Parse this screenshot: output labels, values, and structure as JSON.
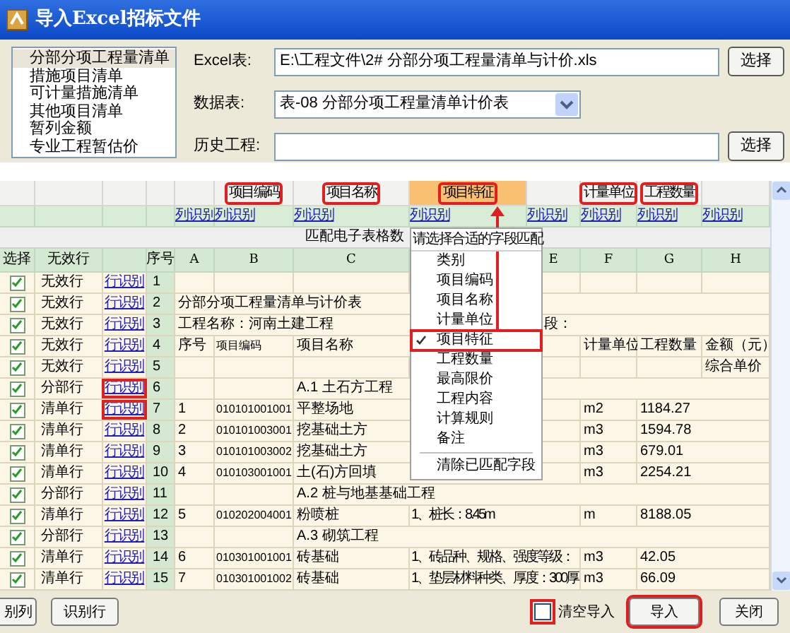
{
  "window": {
    "title": "导入Excel招标文件"
  },
  "sheet_list": {
    "items": [
      {
        "label": "分部分项工程量清单",
        "selected": true
      },
      {
        "label": "措施项目清单",
        "selected": false
      },
      {
        "label": "可计量措施清单",
        "selected": false
      },
      {
        "label": "其他项目清单",
        "selected": false
      },
      {
        "label": "暂列金额",
        "selected": false
      },
      {
        "label": "专业工程暂估价",
        "selected": false
      }
    ]
  },
  "form": {
    "excel_file": {
      "label": "Excel表:",
      "value": "E:\\工程文件\\2# 分部分项工程量清单与计价.xls",
      "button": "选择"
    },
    "data_sheet": {
      "label": "数据表:",
      "value": "表-08 分部分项工程量清单计价表"
    },
    "history_project": {
      "label": "历史工程:",
      "button": "选择"
    }
  },
  "grid": {
    "fixed_headers": {
      "select": "选择",
      "row_type": "无效行",
      "seq": "序号"
    },
    "banner": "匹配电子表格数",
    "columns": [
      {
        "header": "A",
        "link": "列识别",
        "active": false
      },
      {
        "header": "B",
        "link": "列识别",
        "field": "项目编码",
        "active": false,
        "highlighted": true
      },
      {
        "header": "C",
        "link": "列识别",
        "field": "项目名称",
        "active": false,
        "highlighted": true
      },
      {
        "link": "列识别",
        "field": "项目特征",
        "active": true,
        "highlighted": true
      },
      {
        "header": "E",
        "link": "列识别",
        "active": false
      },
      {
        "header": "F",
        "link": "列识别",
        "field": "计量单位",
        "active": false,
        "highlighted": true
      },
      {
        "header": "G",
        "link": "列识别",
        "field": "工程数量",
        "active": false,
        "highlighted": true
      },
      {
        "header": "H",
        "link": "列识别",
        "active": false
      }
    ],
    "rows": [
      {
        "checked": true,
        "type": "无效行",
        "link": "行识别",
        "highlighted": false,
        "seq": "1",
        "cells": {}
      },
      {
        "checked": true,
        "type": "无效行",
        "link": "行识别",
        "highlighted": false,
        "seq": "2",
        "cells": {
          "A": "分部分项工程量清单与计价表"
        }
      },
      {
        "checked": true,
        "type": "无效行",
        "link": "行识别",
        "highlighted": false,
        "seq": "3",
        "cells": {
          "A": "工程名称：河南土建工程",
          "E": "段："
        }
      },
      {
        "checked": true,
        "type": "无效行",
        "link": "行识别",
        "highlighted": false,
        "seq": "4",
        "cells": {
          "A": "序号",
          "B": "项目编码",
          "C": "项目名称",
          "F": "计量单位",
          "G": "工程数量",
          "H": "金额（元）"
        }
      },
      {
        "checked": true,
        "type": "无效行",
        "link": "行识别",
        "highlighted": false,
        "seq": "5",
        "cells": {
          "H": "综合单价"
        }
      },
      {
        "checked": true,
        "type": "分部行",
        "link": "行识别",
        "highlighted": true,
        "seq": "6",
        "cells": {
          "C": "A.1 土石方工程"
        }
      },
      {
        "checked": true,
        "type": "清单行",
        "link": "行识别",
        "highlighted": true,
        "seq": "7",
        "cells": {
          "A": "1",
          "B": "010101001001",
          "C": "平整场地",
          "F": "m2",
          "G": "1184.27"
        }
      },
      {
        "checked": true,
        "type": "清单行",
        "link": "行识别",
        "highlighted": false,
        "seq": "8",
        "cells": {
          "A": "2",
          "B": "010101003001",
          "C": "挖基础土方",
          "F": "m3",
          "G": "1594.78"
        }
      },
      {
        "checked": true,
        "type": "清单行",
        "link": "行识别",
        "highlighted": false,
        "seq": "9",
        "cells": {
          "A": "3",
          "B": "010101003002",
          "C": "挖基础土方",
          "F": "m3",
          "G": "679.01"
        }
      },
      {
        "checked": true,
        "type": "清单行",
        "link": "行识别",
        "highlighted": false,
        "seq": "10",
        "cells": {
          "A": "4",
          "B": "010103001001",
          "C": "土(石)方回填",
          "F": "m3",
          "G": "2254.21"
        }
      },
      {
        "checked": true,
        "type": "分部行",
        "link": "行识别",
        "highlighted": false,
        "seq": "11",
        "cells": {
          "C": "A.2 桩与地基基础工程"
        }
      },
      {
        "checked": true,
        "type": "清单行",
        "link": "行识别",
        "highlighted": false,
        "seq": "12",
        "cells": {
          "A": "5",
          "B": "010202004001",
          "C": "粉喷桩",
          "D": "1、桩长：8.45m",
          "F": "m",
          "G": "8188.05"
        }
      },
      {
        "checked": true,
        "type": "分部行",
        "link": "行识别",
        "highlighted": false,
        "seq": "13",
        "cells": {
          "C": "A.3 砌筑工程"
        }
      },
      {
        "checked": true,
        "type": "清单行",
        "link": "行识别",
        "highlighted": false,
        "seq": "14",
        "cells": {
          "A": "6",
          "B": "010301001001",
          "C": "砖基础",
          "D": "1、砖品种、规格、强度等级：",
          "F": "m3",
          "G": "42.05"
        }
      },
      {
        "checked": true,
        "type": "清单行",
        "link": "行识别",
        "highlighted": false,
        "seq": "15",
        "cells": {
          "A": "7",
          "B": "010301001002",
          "C": "砖基础",
          "D": "1、垫层材料种类、厚度：300厚",
          "F": "m3",
          "G": "66.09"
        }
      }
    ]
  },
  "menu": {
    "title": "请选择合适的字段匹配",
    "items": [
      {
        "label": "类别",
        "checked": false,
        "highlighted": false
      },
      {
        "label": "项目编码",
        "checked": false,
        "highlighted": false
      },
      {
        "label": "项目名称",
        "checked": false,
        "highlighted": false
      },
      {
        "label": "计量单位",
        "checked": false,
        "highlighted": false
      },
      {
        "label": "项目特征",
        "checked": true,
        "highlighted": true
      },
      {
        "label": "工程数量",
        "checked": false,
        "highlighted": false
      },
      {
        "label": "最高限价",
        "checked": false,
        "highlighted": false
      },
      {
        "label": "工程内容",
        "checked": false,
        "highlighted": false
      },
      {
        "label": "计算规则",
        "checked": false,
        "highlighted": false
      },
      {
        "label": "备注",
        "checked": false,
        "highlighted": false
      }
    ],
    "footer": "清除已匹配字段"
  },
  "footer": {
    "left_buttons": [
      "别列",
      "识别行"
    ],
    "clear_import": {
      "label": "清空导入",
      "checked": false,
      "highlighted": true
    },
    "import_button": {
      "label": "导入",
      "highlighted": true
    },
    "close_button": "关闭"
  }
}
